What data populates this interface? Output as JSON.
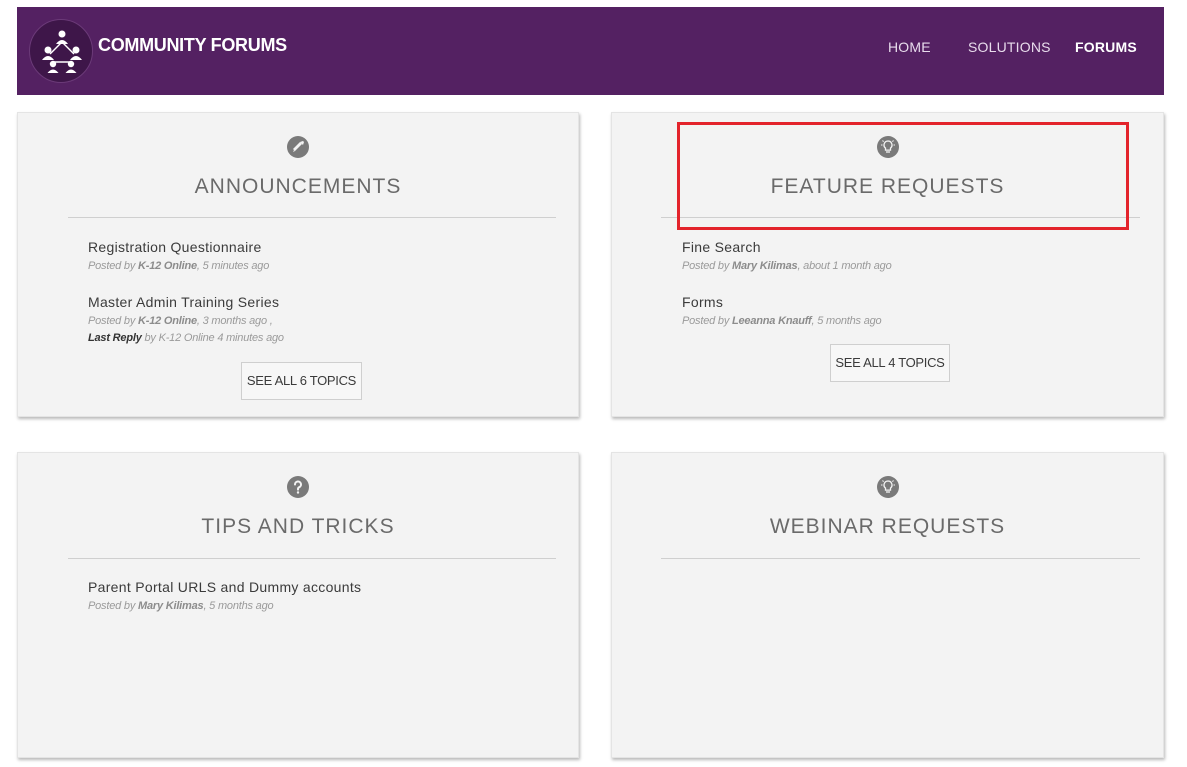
{
  "header": {
    "brand": "COMMUNITY FORUMS",
    "logo_icon": "community-people-icon",
    "background": "#542162",
    "nav": [
      "HOME",
      "SOLUTIONS",
      "FORUMS"
    ],
    "active_nav": "FORUMS"
  },
  "forums": [
    {
      "title": "ANNOUNCEMENTS",
      "icon": "megaphone-icon",
      "topics": [
        {
          "title": "Registration Questionnaire",
          "posted_by": "Posted by",
          "author": "K-12 Online",
          "time": ", 5 minutes ago"
        },
        {
          "title": "Master Admin Training Series",
          "posted_by": "Posted by",
          "author": "K-12 Online",
          "time": ", 3 months ago ,",
          "last_reply_label": "Last Reply",
          "last_reply_text": "by K-12 Online 4 minutes ago"
        }
      ],
      "see_all": "SEE ALL 6 TOPICS"
    },
    {
      "title": "FEATURE REQUESTS",
      "icon": "lightbulb-icon",
      "topics": [
        {
          "title": "Fine Search",
          "posted_by": "Posted by",
          "author": "Mary Kilimas",
          "time": ", about 1 month ago"
        },
        {
          "title": "Forms",
          "posted_by": "Posted by",
          "author": "Leeanna Knauff",
          "time": ", 5 months ago"
        }
      ],
      "see_all": "SEE ALL 4 TOPICS"
    },
    {
      "title": "TIPS AND TRICKS",
      "icon": "question-icon",
      "topics": [
        {
          "title": "Parent Portal URLS and Dummy accounts",
          "posted_by": "Posted by",
          "author": "Mary Kilimas",
          "time": ", 5 months ago"
        }
      ]
    },
    {
      "title": "WEBINAR REQUESTS",
      "icon": "lightbulb-icon",
      "topics": []
    }
  ],
  "highlight_color": "#e3232b"
}
